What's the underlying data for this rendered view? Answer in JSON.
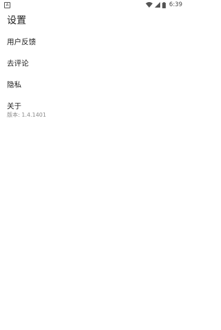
{
  "status_bar": {
    "notification_icon_letter": "A",
    "time": "6:39",
    "icons": [
      "notification-icon",
      "wifi-icon",
      "signal-icon",
      "battery-icon"
    ]
  },
  "header": {
    "title": "设置"
  },
  "menu": {
    "items": [
      {
        "label": "用户反馈"
      },
      {
        "label": "去评论"
      },
      {
        "label": "隐私"
      },
      {
        "label": "关于",
        "sub": "版本: 1.4.1401"
      }
    ]
  },
  "colors": {
    "background": "#ffffff",
    "text_primary": "#212121",
    "text_secondary": "#8a8a8a"
  }
}
